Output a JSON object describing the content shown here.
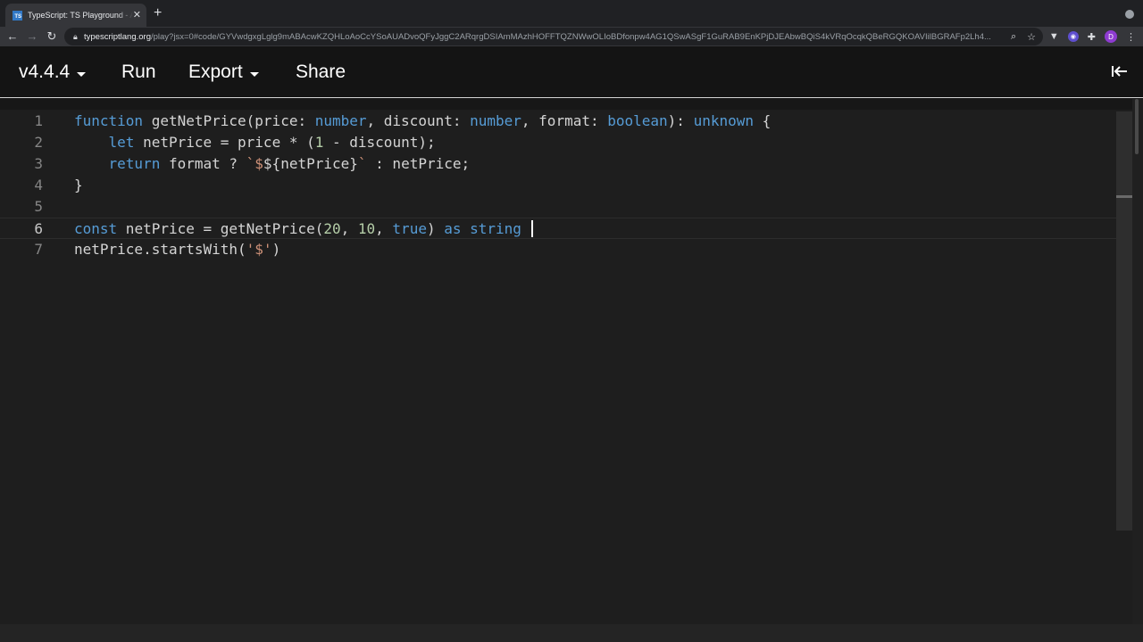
{
  "browser": {
    "tab_title": "TypeScript: TS Playground - A",
    "favicon_text": "TS",
    "url_host": "typescriptlang.org",
    "url_path": "/play?jsx=0#code/GYVwdgxgLglg9mABAcwKZQHLoAoCcYSoAUADvoQFyJggC2ARqrgDSIAmMAzhHOFFTQZNWwOLIoBDfonpw4AG1QSwASgF1GuRAB9EnKPjDJEAbwBQiS4kVRqOcqkQBeRGQKOAVIilBGRAFp2Lh4..."
  },
  "playground": {
    "version_label": "v4.4.4",
    "run_label": "Run",
    "export_label": "Export",
    "share_label": "Share"
  },
  "editor": {
    "lines": [
      {
        "number": "1",
        "tokens": [
          {
            "t": "function",
            "c": "kw"
          },
          {
            "t": " getNetPrice(price: ",
            "c": "plain"
          },
          {
            "t": "number",
            "c": "kw"
          },
          {
            "t": ", discount: ",
            "c": "plain"
          },
          {
            "t": "number",
            "c": "kw"
          },
          {
            "t": ", format: ",
            "c": "plain"
          },
          {
            "t": "boolean",
            "c": "kw"
          },
          {
            "t": "): ",
            "c": "plain"
          },
          {
            "t": "unknown",
            "c": "kw"
          },
          {
            "t": " {",
            "c": "plain"
          }
        ]
      },
      {
        "number": "2",
        "tokens": [
          {
            "t": "    ",
            "c": "plain"
          },
          {
            "t": "let",
            "c": "kw"
          },
          {
            "t": " netPrice = price * (",
            "c": "plain"
          },
          {
            "t": "1",
            "c": "num"
          },
          {
            "t": " - discount);",
            "c": "plain"
          }
        ]
      },
      {
        "number": "3",
        "tokens": [
          {
            "t": "    ",
            "c": "plain"
          },
          {
            "t": "return",
            "c": "ctl"
          },
          {
            "t": " format ? ",
            "c": "plain"
          },
          {
            "t": "`$",
            "c": "str"
          },
          {
            "t": "${netPrice}",
            "c": "tpl"
          },
          {
            "t": "`",
            "c": "str"
          },
          {
            "t": " : netPrice;",
            "c": "plain"
          }
        ]
      },
      {
        "number": "4",
        "tokens": [
          {
            "t": "}",
            "c": "plain"
          }
        ]
      },
      {
        "number": "5",
        "tokens": []
      },
      {
        "number": "6",
        "current": true,
        "cursor": true,
        "tokens": [
          {
            "t": "const",
            "c": "kw"
          },
          {
            "t": " netPrice = getNetPrice(",
            "c": "plain"
          },
          {
            "t": "20",
            "c": "num"
          },
          {
            "t": ", ",
            "c": "plain"
          },
          {
            "t": "10",
            "c": "num"
          },
          {
            "t": ", ",
            "c": "plain"
          },
          {
            "t": "true",
            "c": "kw"
          },
          {
            "t": ") ",
            "c": "plain"
          },
          {
            "t": "as",
            "c": "kw"
          },
          {
            "t": " ",
            "c": "plain"
          },
          {
            "t": "string",
            "c": "kw"
          },
          {
            "t": " ",
            "c": "plain"
          }
        ]
      },
      {
        "number": "7",
        "tokens": [
          {
            "t": "netPrice.startsWith(",
            "c": "plain"
          },
          {
            "t": "'$'",
            "c": "str"
          },
          {
            "t": ")",
            "c": "plain"
          }
        ]
      }
    ]
  },
  "colors": {
    "keyword": "#569cd6",
    "number": "#b5cea8",
    "string": "#ce9178",
    "text": "#d4d4d4",
    "editor_bg": "#1e1e1e"
  },
  "icons": [
    "back-icon",
    "forward-icon",
    "reload-icon",
    "lock-icon",
    "zoom-icon",
    "star-icon",
    "extensions-icon",
    "collapse-sidebar-icon"
  ]
}
